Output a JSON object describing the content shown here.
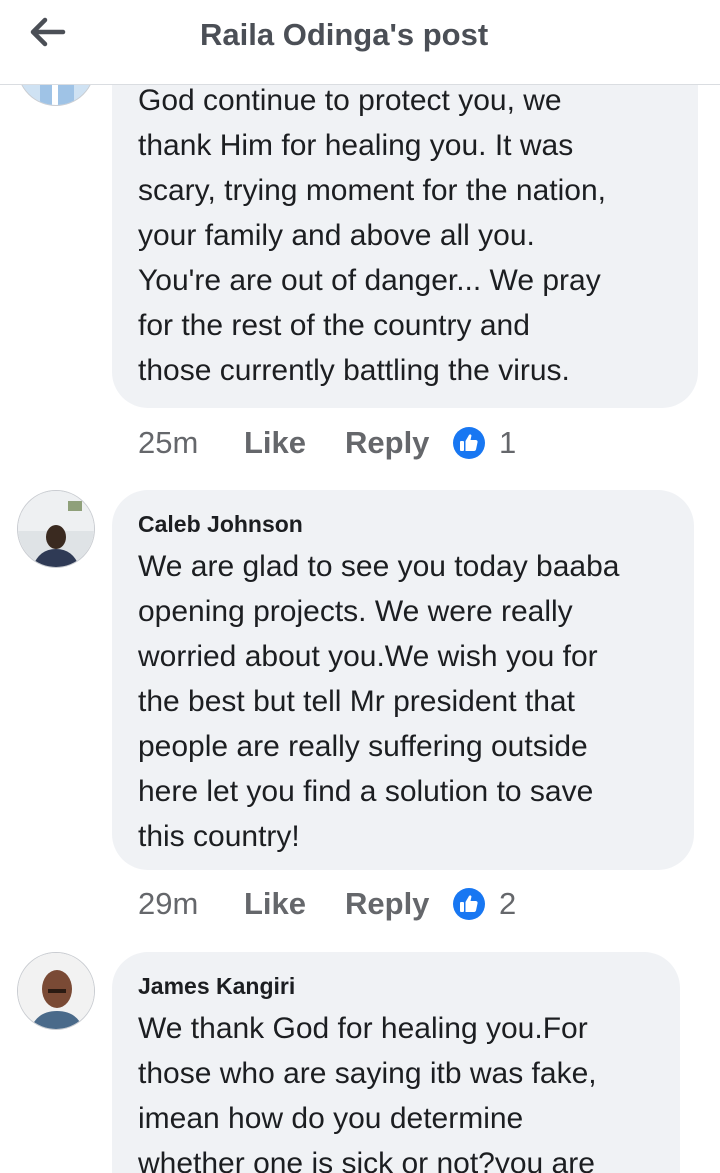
{
  "header": {
    "title": "Raila Odinga's post"
  },
  "comments": [
    {
      "author": "",
      "lines": [
        "God continue to protect you, we",
        "thank Him for healing you. It was",
        "scary, trying moment for the nation,",
        "your family and above all you.",
        "You're are out of danger... We pray",
        "for the rest of the country and",
        "those currently battling the virus."
      ],
      "time": "25m",
      "like_label": "Like",
      "reply_label": "Reply",
      "reaction_count": "1"
    },
    {
      "author": "Caleb Johnson",
      "lines": [
        "We are glad to see you today baaba",
        "opening projects. We were really",
        "worried about you.We wish you for",
        "the best but tell Mr president that",
        "people are really suffering outside",
        "here let you find a solution to save",
        "this country!"
      ],
      "time": "29m",
      "like_label": "Like",
      "reply_label": "Reply",
      "reaction_count": "2"
    },
    {
      "author": "James Kangiri",
      "lines": [
        "We thank God for healing you.For",
        "those who are saying itb was fake,",
        "imean how do you determine",
        "whether one is sick or not?you are"
      ]
    }
  ],
  "colors": {
    "bubble": "#f0f2f5",
    "like_blue": "#1877f2",
    "meta_gray": "#65676b"
  }
}
